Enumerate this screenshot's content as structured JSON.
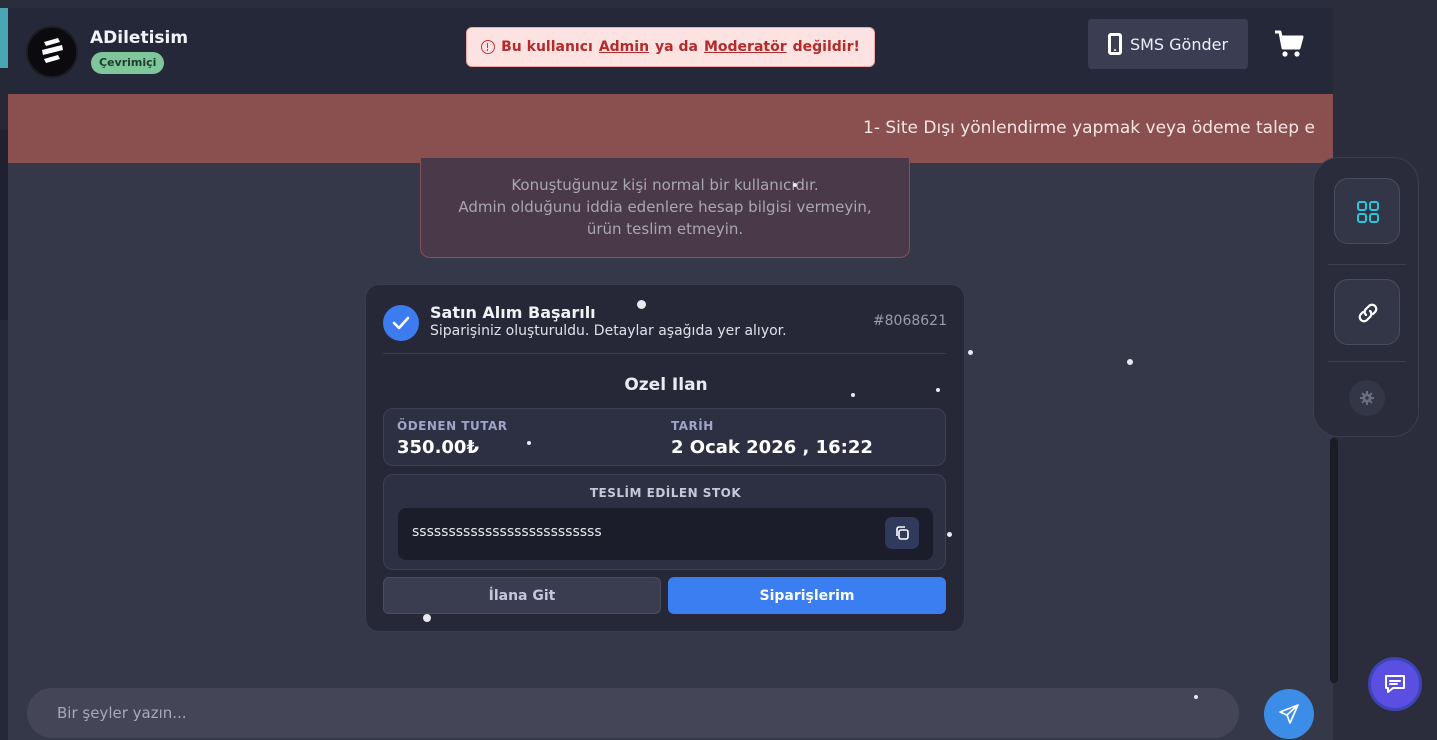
{
  "header": {
    "username": "ADiletisim",
    "status": "Çevrimiçi",
    "warning": {
      "prefix": "Bu kullanıcı",
      "role1": "Admin",
      "middle": "ya da",
      "role2": "Moderatör",
      "suffix": "değildir!"
    },
    "sms_label": "SMS Gönder"
  },
  "rules_banner": {
    "text": "1- Site Dışı yönlendirme yapmak veya ödeme talep e"
  },
  "admin_notice": {
    "line1": "Konuştuğunuz kişi normal bir kullanıcıdır.",
    "line2": "Admin olduğunu iddia edenlere hesap bilgisi vermeyin,",
    "line3": "ürün teslim etmeyin."
  },
  "order_card": {
    "title": "Satın Alım Başarılı",
    "subtitle": "Siparişiniz oluşturuldu. Detaylar aşağıda yer alıyor.",
    "order_id": "#8068621",
    "product": "Ozel Ilan",
    "paid_label": "ÖDENEN TUTAR",
    "paid_value": "350.00₺",
    "date_label": "TARİH",
    "date_value": "2 Ocak 2026 , 16:22",
    "stock_label": "TESLİM EDİLEN STOK",
    "stock_value": "ssssssssssssssssssssssssss",
    "goto_label": "İlana Git",
    "orders_label": "Siparişlerim"
  },
  "composer": {
    "placeholder": "Bir şeyler yazın..."
  },
  "icons": {
    "cart": "cart-icon",
    "phone": "phone-icon",
    "grid": "grid-icon",
    "link": "link-icon",
    "gear": "gear-icon",
    "send": "send-icon",
    "support": "chat-support-icon"
  },
  "colors": {
    "accent_blue": "#3b7ef2",
    "status_green": "#7fc69a",
    "warning_red": "#b52b2b",
    "banner_red": "#8a4f4f",
    "support_purple": "#5a4fe0"
  }
}
